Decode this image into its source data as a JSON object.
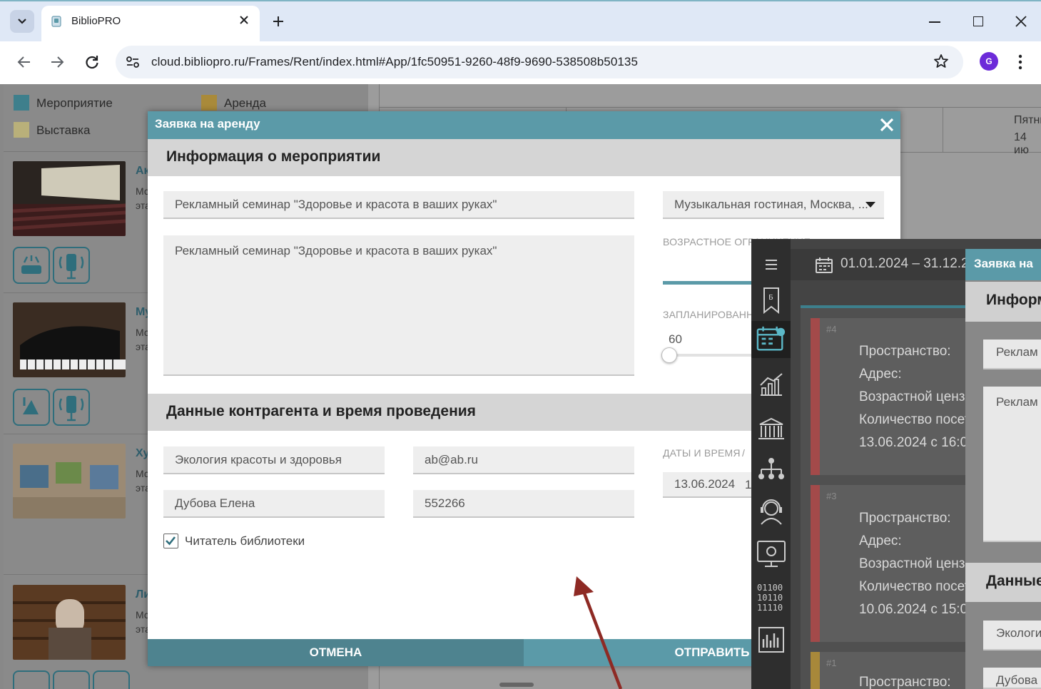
{
  "browser": {
    "tab_title": "BiblioPRO",
    "url": "cloud.bibliopro.ru/Frames/Rent/index.html#App/1fc50951-9260-48f9-9690-538508b50135",
    "profile_initial": "G"
  },
  "background": {
    "legend": [
      {
        "label": "Мероприятие",
        "color": "#3e7f8c"
      },
      {
        "label": "Аренда",
        "color": "#a98a3a"
      },
      {
        "label": "Выставка",
        "color": "#b9b07a"
      }
    ],
    "cards": [
      {
        "letter": "Ак",
        "sub1": "Мс",
        "sub2": "эта"
      },
      {
        "letter": "Му",
        "sub1": "Мс",
        "sub2": "эта"
      },
      {
        "letter": "Ху",
        "sub1": "Мс",
        "sub2": "эта"
      },
      {
        "letter": "Ли",
        "sub1": "Мс",
        "sub2": "эта"
      }
    ],
    "day_header": {
      "line1": "Пятни",
      "line2": "14 ию"
    }
  },
  "modal": {
    "title": "Заявка на аренду",
    "section_event": "Информация о мероприятии",
    "event_name": "Рекламный семинар \"Здоровье и красота в ваших руках\"",
    "event_description": "Рекламный семинар \"Здоровье и красота в ваших руках\"",
    "venue": "Музыкальная гостиная, Москва, ...",
    "age_label": "ВОЗРАСТНОЕ ОГРАНИЧЕНИЕ",
    "planned_label": "ЗАПЛАНИРОВАНН",
    "planned_value": "60",
    "section_contractor": "Данные контрагента и время проведения",
    "org_name": "Экология красоты и здоровья",
    "email": "ab@ab.ru",
    "contact_person": "Дубова Елена",
    "phone": "552266",
    "reader_checkbox_label": "Читатель библиотеки",
    "reader_checked": true,
    "dates_label": "ДАТЫ И ВРЕМЯ",
    "dates_sep": "/",
    "date_value": "13.06.2024",
    "time_fragment": "1",
    "cancel_label": "ОТМЕНА",
    "submit_label": "ОТПРАВИТЬ"
  },
  "overlay": {
    "date_range": "01.01.2024 – 31.12.2",
    "events": [
      {
        "num": "#4",
        "color": "#a34a4a",
        "lines": [
          "Пространство:",
          "Адрес:",
          "Возрастной ценз м",
          "Количество посети",
          "13.06.2024 с 16:0"
        ]
      },
      {
        "num": "#3",
        "color": "#a34a4a",
        "lines": [
          "Пространство:",
          "Адрес:",
          "Возрастной ценз м",
          "Количество посети",
          "10.06.2024 с 15:0"
        ]
      },
      {
        "num": "#1",
        "color": "#a8883a",
        "lines": [
          "Пространство:"
        ]
      }
    ],
    "modal2_title": "Заявка на",
    "modal2_section1": "Информ",
    "modal2_field1": "Реклам",
    "modal2_field2": "Реклам",
    "modal2_section2": "Данные",
    "modal2_field3": "Экологи",
    "modal2_field4": "Дубова"
  }
}
